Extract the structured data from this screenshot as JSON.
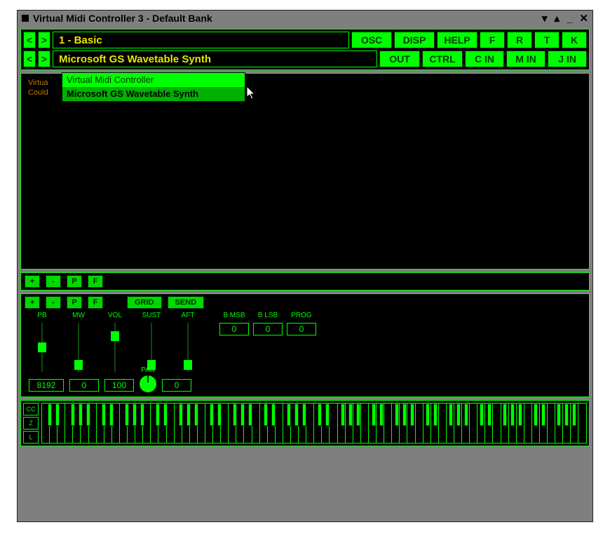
{
  "window": {
    "title": "Virtual Midi Controller 3 - Default Bank"
  },
  "row1": {
    "display": "1 - Basic",
    "buttons": [
      "OSC",
      "DISP",
      "HELP",
      "F",
      "R",
      "T",
      "K"
    ]
  },
  "row2": {
    "display": "Microsoft GS Wavetable Synth",
    "buttons": [
      "OUT",
      "CTRL",
      "C IN",
      "M IN",
      "J IN"
    ]
  },
  "status": {
    "line1": "Virtua",
    "line2": "Could"
  },
  "dropdown": {
    "items": [
      {
        "label": "Virtual Midi Controller",
        "selected": false
      },
      {
        "label": "Microsoft GS Wavetable Synth",
        "selected": true
      }
    ]
  },
  "pf1": [
    "+",
    "-",
    "P",
    "F"
  ],
  "pf2": {
    "small": [
      "+",
      "-",
      "P",
      "F"
    ],
    "wide": [
      "GRID",
      "SEND"
    ]
  },
  "sliders": [
    {
      "name": "PB",
      "pos": 0.5
    },
    {
      "name": "MW",
      "pos": 0.95
    },
    {
      "name": "VOL",
      "pos": 0.22
    },
    {
      "name": "SUST",
      "pos": 0.95
    },
    {
      "name": "AFT",
      "pos": 0.95
    }
  ],
  "numboxes": [
    {
      "label": "B MSB",
      "value": "0"
    },
    {
      "label": "B LSB",
      "value": "0"
    },
    {
      "label": "PROG",
      "value": "0"
    }
  ],
  "bottom": {
    "pb": "8192",
    "mw": "0",
    "vol": "100",
    "pan_label": "PAN",
    "aft": "0"
  },
  "kb_side": [
    "CC",
    "Z",
    "L"
  ],
  "kb": {
    "white_keys": 70
  }
}
